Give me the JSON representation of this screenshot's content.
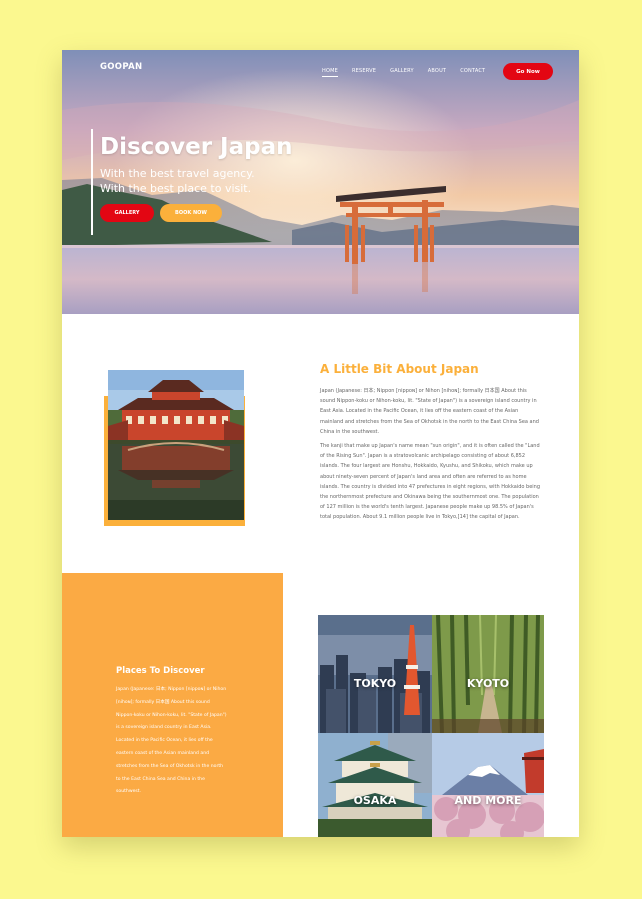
{
  "nav": {
    "logo": "GOOPAN",
    "items": [
      {
        "label": "HOME",
        "active": true
      },
      {
        "label": "RESERVE",
        "active": false
      },
      {
        "label": "GALLERY",
        "active": false
      },
      {
        "label": "ABOUT",
        "active": false
      },
      {
        "label": "CONTACT",
        "active": false
      }
    ],
    "cta": "Go Now"
  },
  "hero": {
    "title": "Discover Japan",
    "subtitle_line1": "With the best travel agency.",
    "subtitle_line2": "With the best place to visit.",
    "gallery_button": "GALLERY",
    "book_button": "BOOK NOW"
  },
  "about": {
    "title": "A Little Bit About Japan",
    "paragraph1": "Japan (Japanese: 日本; Nippon [nippoɴ] or Nihon [nihoɴ]; formally 日本国 About this sound Nippon-koku or Nihon-koku, lit. \"State of Japan\") is a sovereign island country in East Asia. Located in the Pacific Ocean, it lies off the eastern coast of the Asian mainland and stretches from the Sea of Okhotsk in the north to the East China Sea and China in the southwest.",
    "paragraph2": "The kanji that make up Japan's name mean \"sun origin\", and it is often called the \"Land of the Rising Sun\". Japan is a stratovolcanic archipelago consisting of about 6,852 islands. The four largest are Honshu, Hokkaido, Kyushu, and Shikoku, which make up about ninety-seven percent of Japan's land area and often are referred to as home islands. The country is divided into 47 prefectures in eight regions, with Hokkaido being the northernmost prefecture and Okinawa being the southernmost one. The population of 127 million is the world's tenth largest. Japanese people make up 98.5% of Japan's total population. About 9.1 million people live in Tokyo,[14] the capital of Japan."
  },
  "places": {
    "title": "Places To Discover",
    "text": "Japan (Japanese: 日本; Nippon [nippoɴ] or Nihon [nihoɴ]; formally 日本国 About this sound Nippon-koku or Nihon-koku, lit. \"State of Japan\") is a sovereign island country in East Asia. Located in the Pacific Ocean, it lies off the eastern coast of the Asian mainland and stretches from the Sea of Okhotsk in the north to the East China Sea and China in the southwest.",
    "tiles": [
      "TOKYO",
      "KYOTO",
      "OSAKA",
      "AND MORE"
    ]
  },
  "colors": {
    "background": "#fbf88f",
    "accent_red": "#e30613",
    "accent_orange": "#fbb03b"
  }
}
